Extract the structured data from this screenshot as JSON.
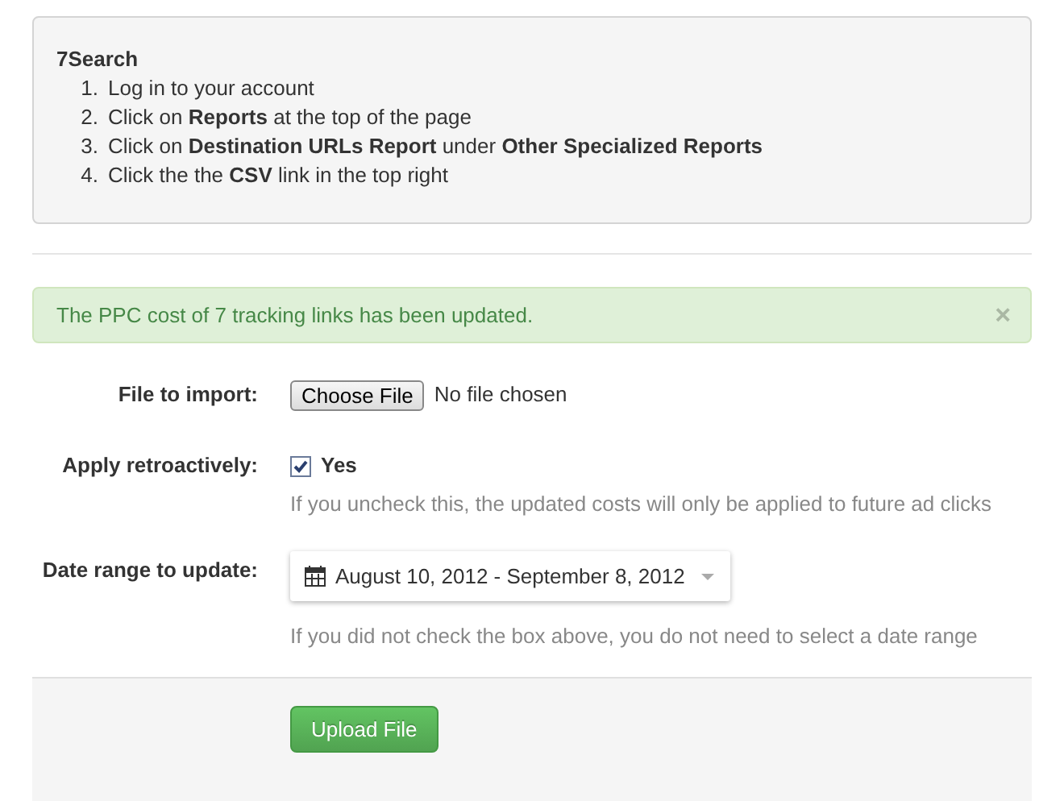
{
  "instructions": {
    "title": "7Search",
    "steps": [
      {
        "number": "1.",
        "text": "Log in to your account"
      },
      {
        "number": "2.",
        "text": "Click on **Reports** at the top of the page"
      },
      {
        "number": "3.",
        "text": "Click on **Destination URLs Report** under **Other Specialized Reports**"
      },
      {
        "number": "4.",
        "text": "Click the the **CSV** link in the top right"
      }
    ]
  },
  "alert": {
    "message": "The PPC cost of 7 tracking links has been updated.",
    "close": "×"
  },
  "form": {
    "file": {
      "label": "File to import:",
      "button": "Choose File",
      "status": "No file chosen"
    },
    "retro": {
      "label": "Apply retroactively:",
      "option": "Yes",
      "checked": true,
      "help": "If you uncheck this, the updated costs will only be applied to future ad clicks"
    },
    "date": {
      "label": "Date range to update:",
      "value": "August 10, 2012 - September 8, 2012",
      "help": "If you did not check the box above, you do not need to select a date range"
    },
    "submit": "Upload File"
  }
}
